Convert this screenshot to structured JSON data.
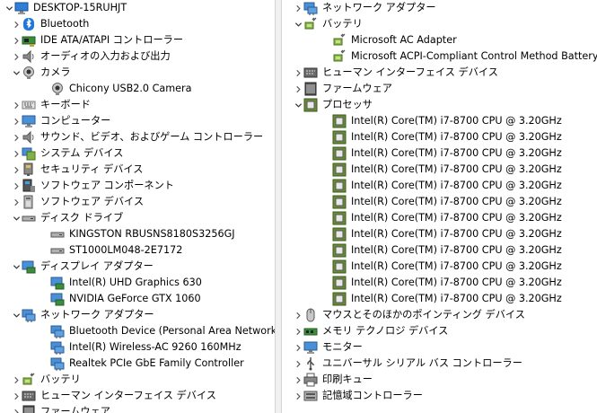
{
  "left": {
    "rows": [
      {
        "label": "DESKTOP-15RUHJT",
        "level": 0,
        "state": "expanded",
        "icon": "computer-icon",
        "name": "tree-root-desktop"
      },
      {
        "label": "Bluetooth",
        "level": 1,
        "state": "collapsed",
        "icon": "bluetooth-icon",
        "name": "tree-item-bluetooth"
      },
      {
        "label": "IDE ATA/ATAPI コントローラー",
        "level": 1,
        "state": "collapsed",
        "icon": "ide-controller-icon",
        "name": "tree-item-ide-controller"
      },
      {
        "label": "オーディオの入力および出力",
        "level": 1,
        "state": "collapsed",
        "icon": "speaker-icon",
        "name": "tree-item-audio-io"
      },
      {
        "label": "カメラ",
        "level": 1,
        "state": "expanded",
        "icon": "camera-icon",
        "name": "tree-item-camera"
      },
      {
        "label": "Chicony USB2.0 Camera",
        "level": 2,
        "state": "leaf",
        "icon": "camera-icon",
        "name": "tree-item-chicony-camera"
      },
      {
        "label": "キーボード",
        "level": 1,
        "state": "collapsed",
        "icon": "keyboard-icon",
        "name": "tree-item-keyboard"
      },
      {
        "label": "コンピューター",
        "level": 1,
        "state": "collapsed",
        "icon": "monitor-icon",
        "name": "tree-item-computer"
      },
      {
        "label": "サウンド、ビデオ、およびゲーム コントローラー",
        "level": 1,
        "state": "collapsed",
        "icon": "speaker-icon",
        "name": "tree-item-sound-video"
      },
      {
        "label": "システム デバイス",
        "level": 1,
        "state": "collapsed",
        "icon": "system-device-icon",
        "name": "tree-item-system-devices"
      },
      {
        "label": "セキュリティ デバイス",
        "level": 1,
        "state": "collapsed",
        "icon": "security-device-icon",
        "name": "tree-item-security-devices"
      },
      {
        "label": "ソフトウェア コンポーネント",
        "level": 1,
        "state": "collapsed",
        "icon": "software-component-icon",
        "name": "tree-item-software-components"
      },
      {
        "label": "ソフトウェア デバイス",
        "level": 1,
        "state": "collapsed",
        "icon": "software-device-icon",
        "name": "tree-item-software-devices"
      },
      {
        "label": "ディスク ドライブ",
        "level": 1,
        "state": "expanded",
        "icon": "disk-drive-icon",
        "name": "tree-item-disk-drives"
      },
      {
        "label": "KINGSTON RBUSNS8180S3256GJ",
        "level": 2,
        "state": "leaf",
        "icon": "disk-drive-icon",
        "name": "tree-item-kingston-ssd"
      },
      {
        "label": "ST1000LM048-2E7172",
        "level": 2,
        "state": "leaf",
        "icon": "disk-drive-icon",
        "name": "tree-item-seagate-hdd"
      },
      {
        "label": "ディスプレイ アダプター",
        "level": 1,
        "state": "expanded",
        "icon": "display-adapter-icon",
        "name": "tree-item-display-adapters"
      },
      {
        "label": "Intel(R) UHD Graphics 630",
        "level": 2,
        "state": "leaf",
        "icon": "display-adapter-icon",
        "name": "tree-item-intel-uhd"
      },
      {
        "label": "NVIDIA GeForce GTX 1060",
        "level": 2,
        "state": "leaf",
        "icon": "display-adapter-icon",
        "name": "tree-item-nvidia-gtx"
      },
      {
        "label": "ネットワーク アダプター",
        "level": 1,
        "state": "expanded",
        "icon": "network-adapter-icon",
        "name": "tree-item-network-adapters"
      },
      {
        "label": "Bluetooth Device (Personal Area Network)",
        "level": 2,
        "state": "leaf",
        "icon": "network-adapter-icon",
        "name": "tree-item-bt-pan"
      },
      {
        "label": "Intel(R) Wireless-AC 9260 160MHz",
        "level": 2,
        "state": "leaf",
        "icon": "network-adapter-icon",
        "name": "tree-item-intel-wireless"
      },
      {
        "label": "Realtek PCIe GbE Family Controller",
        "level": 2,
        "state": "leaf",
        "icon": "network-adapter-icon",
        "name": "tree-item-realtek-gbe"
      },
      {
        "label": "バッテリ",
        "level": 1,
        "state": "collapsed",
        "icon": "battery-icon",
        "name": "tree-item-batteries"
      },
      {
        "label": "ヒューマン インターフェイス デバイス",
        "level": 1,
        "state": "collapsed",
        "icon": "hid-icon",
        "name": "tree-item-hid"
      },
      {
        "label": "ファームウェア",
        "level": 1,
        "state": "collapsed",
        "icon": "firmware-icon",
        "name": "tree-item-firmware"
      }
    ]
  },
  "right": {
    "rows": [
      {
        "label": "ネットワーク アダプター",
        "level": 1,
        "state": "collapsed",
        "icon": "network-adapter-icon",
        "name": "tree-item-network-adapters"
      },
      {
        "label": "バッテリ",
        "level": 1,
        "state": "expanded",
        "icon": "battery-icon",
        "name": "tree-item-batteries"
      },
      {
        "label": "Microsoft AC Adapter",
        "level": 2,
        "state": "leaf",
        "icon": "battery-icon",
        "name": "tree-item-ac-adapter"
      },
      {
        "label": "Microsoft ACPI-Compliant Control Method Battery",
        "level": 2,
        "state": "leaf",
        "icon": "battery-icon",
        "name": "tree-item-acpi-battery"
      },
      {
        "label": "ヒューマン インターフェイス デバイス",
        "level": 1,
        "state": "collapsed",
        "icon": "hid-icon",
        "name": "tree-item-hid"
      },
      {
        "label": "ファームウェア",
        "level": 1,
        "state": "collapsed",
        "icon": "firmware-icon",
        "name": "tree-item-firmware"
      },
      {
        "label": "プロセッサ",
        "level": 1,
        "state": "expanded",
        "icon": "processor-icon",
        "name": "tree-item-processors"
      },
      {
        "label": "Intel(R) Core(TM) i7-8700 CPU @ 3.20GHz",
        "level": 2,
        "state": "leaf",
        "icon": "processor-icon",
        "name": "tree-item-cpu-core"
      },
      {
        "label": "Intel(R) Core(TM) i7-8700 CPU @ 3.20GHz",
        "level": 2,
        "state": "leaf",
        "icon": "processor-icon",
        "name": "tree-item-cpu-core"
      },
      {
        "label": "Intel(R) Core(TM) i7-8700 CPU @ 3.20GHz",
        "level": 2,
        "state": "leaf",
        "icon": "processor-icon",
        "name": "tree-item-cpu-core"
      },
      {
        "label": "Intel(R) Core(TM) i7-8700 CPU @ 3.20GHz",
        "level": 2,
        "state": "leaf",
        "icon": "processor-icon",
        "name": "tree-item-cpu-core"
      },
      {
        "label": "Intel(R) Core(TM) i7-8700 CPU @ 3.20GHz",
        "level": 2,
        "state": "leaf",
        "icon": "processor-icon",
        "name": "tree-item-cpu-core"
      },
      {
        "label": "Intel(R) Core(TM) i7-8700 CPU @ 3.20GHz",
        "level": 2,
        "state": "leaf",
        "icon": "processor-icon",
        "name": "tree-item-cpu-core"
      },
      {
        "label": "Intel(R) Core(TM) i7-8700 CPU @ 3.20GHz",
        "level": 2,
        "state": "leaf",
        "icon": "processor-icon",
        "name": "tree-item-cpu-core"
      },
      {
        "label": "Intel(R) Core(TM) i7-8700 CPU @ 3.20GHz",
        "level": 2,
        "state": "leaf",
        "icon": "processor-icon",
        "name": "tree-item-cpu-core"
      },
      {
        "label": "Intel(R) Core(TM) i7-8700 CPU @ 3.20GHz",
        "level": 2,
        "state": "leaf",
        "icon": "processor-icon",
        "name": "tree-item-cpu-core"
      },
      {
        "label": "Intel(R) Core(TM) i7-8700 CPU @ 3.20GHz",
        "level": 2,
        "state": "leaf",
        "icon": "processor-icon",
        "name": "tree-item-cpu-core"
      },
      {
        "label": "Intel(R) Core(TM) i7-8700 CPU @ 3.20GHz",
        "level": 2,
        "state": "leaf",
        "icon": "processor-icon",
        "name": "tree-item-cpu-core"
      },
      {
        "label": "Intel(R) Core(TM) i7-8700 CPU @ 3.20GHz",
        "level": 2,
        "state": "leaf",
        "icon": "processor-icon",
        "name": "tree-item-cpu-core"
      },
      {
        "label": "マウスとそのほかのポインティング デバイス",
        "level": 1,
        "state": "collapsed",
        "icon": "mouse-icon",
        "name": "tree-item-mice"
      },
      {
        "label": "メモリ テクノロジ デバイス",
        "level": 1,
        "state": "collapsed",
        "icon": "memory-device-icon",
        "name": "tree-item-memory-tech"
      },
      {
        "label": "モニター",
        "level": 1,
        "state": "collapsed",
        "icon": "monitor-icon",
        "name": "tree-item-monitors"
      },
      {
        "label": "ユニバーサル シリアル バス コントローラー",
        "level": 1,
        "state": "collapsed",
        "icon": "usb-icon",
        "name": "tree-item-usb-controllers"
      },
      {
        "label": "印刷キュー",
        "level": 1,
        "state": "collapsed",
        "icon": "printer-icon",
        "name": "tree-item-print-queues"
      },
      {
        "label": "記憶域コントローラー",
        "level": 1,
        "state": "collapsed",
        "icon": "storage-controller-icon",
        "name": "tree-item-storage-controllers"
      }
    ]
  }
}
